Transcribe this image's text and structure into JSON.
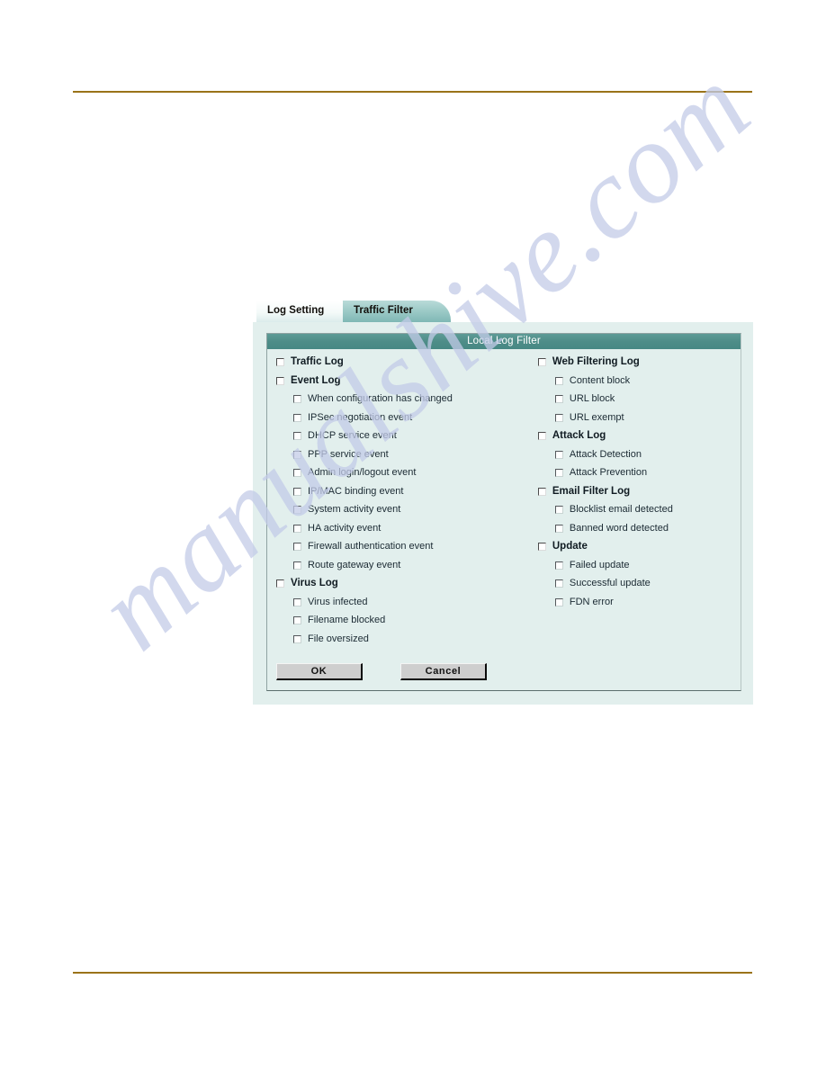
{
  "page": {
    "rule_color": "#9a7319",
    "watermark": "manualshive.com"
  },
  "figure": {
    "tabs": [
      {
        "label": "Log Setting",
        "state": "active"
      },
      {
        "label": "Traffic Filter",
        "state": "inactive"
      }
    ],
    "panel": {
      "title": "Local Log Filter",
      "title_bg": "#4e8d88",
      "background": "#e2efed",
      "left_column": [
        {
          "label": "Traffic Log",
          "level": "top",
          "checked": false
        },
        {
          "label": "Event Log",
          "level": "top",
          "checked": false
        },
        {
          "label": "When configuration has changed",
          "level": "child",
          "checked": false
        },
        {
          "label": "IPSec negotiation event",
          "level": "child",
          "checked": false
        },
        {
          "label": "DHCP service event",
          "level": "child",
          "checked": false
        },
        {
          "label": "PPP service event",
          "level": "child",
          "checked": false
        },
        {
          "label": "Admin login/logout event",
          "level": "child",
          "checked": false
        },
        {
          "label": "IP/MAC binding event",
          "level": "child",
          "checked": false
        },
        {
          "label": "System activity event",
          "level": "child",
          "checked": false
        },
        {
          "label": "HA activity event",
          "level": "child",
          "checked": false
        },
        {
          "label": "Firewall authentication event",
          "level": "child",
          "checked": false
        },
        {
          "label": "Route gateway event",
          "level": "child",
          "checked": false
        },
        {
          "label": "Virus Log",
          "level": "top",
          "checked": false
        },
        {
          "label": "Virus infected",
          "level": "child",
          "checked": false
        },
        {
          "label": "Filename blocked",
          "level": "child",
          "checked": false
        },
        {
          "label": "File oversized",
          "level": "child",
          "checked": false
        }
      ],
      "right_column": [
        {
          "label": "Web Filtering Log",
          "level": "top",
          "checked": false
        },
        {
          "label": "Content block",
          "level": "child",
          "checked": false
        },
        {
          "label": "URL block",
          "level": "child",
          "checked": false
        },
        {
          "label": "URL exempt",
          "level": "child",
          "checked": false
        },
        {
          "label": "Attack Log",
          "level": "top",
          "checked": false
        },
        {
          "label": "Attack Detection",
          "level": "child",
          "checked": false
        },
        {
          "label": "Attack Prevention",
          "level": "child",
          "checked": false
        },
        {
          "label": "Email Filter Log",
          "level": "top",
          "checked": false
        },
        {
          "label": "Blocklist email detected",
          "level": "child",
          "checked": false
        },
        {
          "label": "Banned word detected",
          "level": "child",
          "checked": false
        },
        {
          "label": "Update",
          "level": "top",
          "checked": false
        },
        {
          "label": "Failed update",
          "level": "child",
          "checked": false
        },
        {
          "label": "Successful update",
          "level": "child",
          "checked": false
        },
        {
          "label": "FDN error",
          "level": "child",
          "checked": false
        }
      ],
      "buttons": [
        {
          "label": "OK",
          "name": "ok-button"
        },
        {
          "label": "Cancel",
          "name": "cancel-button"
        }
      ]
    }
  }
}
